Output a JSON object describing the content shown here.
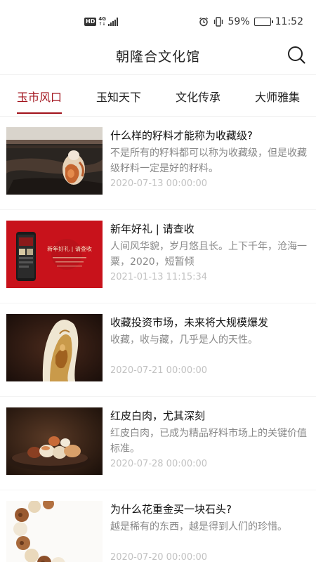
{
  "status_bar": {
    "hd": "HD",
    "network": "4G",
    "battery": "59%",
    "battery_level": 0.59,
    "time": "11:52"
  },
  "header": {
    "title": "朝隆合文化馆",
    "search_icon": "search-icon"
  },
  "tabs": [
    {
      "label": "玉市风口",
      "active": true
    },
    {
      "label": "玉知天下",
      "active": false
    },
    {
      "label": "文化传承",
      "active": false
    },
    {
      "label": "大师雅集",
      "active": false
    }
  ],
  "colors": {
    "accent": "#a1121b",
    "text_primary": "#111111",
    "text_secondary": "#888888",
    "text_date": "#c2c2c2"
  },
  "news": [
    {
      "title": "什么样的籽料才能称为收藏级?",
      "summary": "不是所有的籽料都可以称为收藏级，但是收藏级籽料一定是好的籽料。",
      "date": "2020-07-13 00:00:00",
      "thumb": "carved-jade-on-wood"
    },
    {
      "title": "新年好礼 | 请查收",
      "summary": "人间风华貌，岁月悠且长。上下千年，沧海一粟，2020，短暂倾",
      "date": "2021-01-13 11:15:34",
      "thumb": "new-year-gift-red-banner",
      "thumb_text": "新年好礼 | 请查收"
    },
    {
      "title": "收藏投资市场，未来将大规模爆发",
      "summary": "收藏，收与藏，几乎是人的天性。",
      "date": "2020-07-21 00:00:00",
      "thumb": "carved-jade-pendant"
    },
    {
      "title": "红皮白肉，尤其深刻",
      "summary": "红皮白肉，已成为精品籽料市场上的关键价值标准。",
      "date": "2020-07-28 00:00:00",
      "thumb": "jade-pebbles-on-plate"
    },
    {
      "title": "为什么花重金买一块石头?",
      "summary": "越是稀有的东西，越是得到人们的珍惜。",
      "date": "2020-07-20 00:00:00",
      "thumb": "jade-bead-bracelet"
    }
  ]
}
